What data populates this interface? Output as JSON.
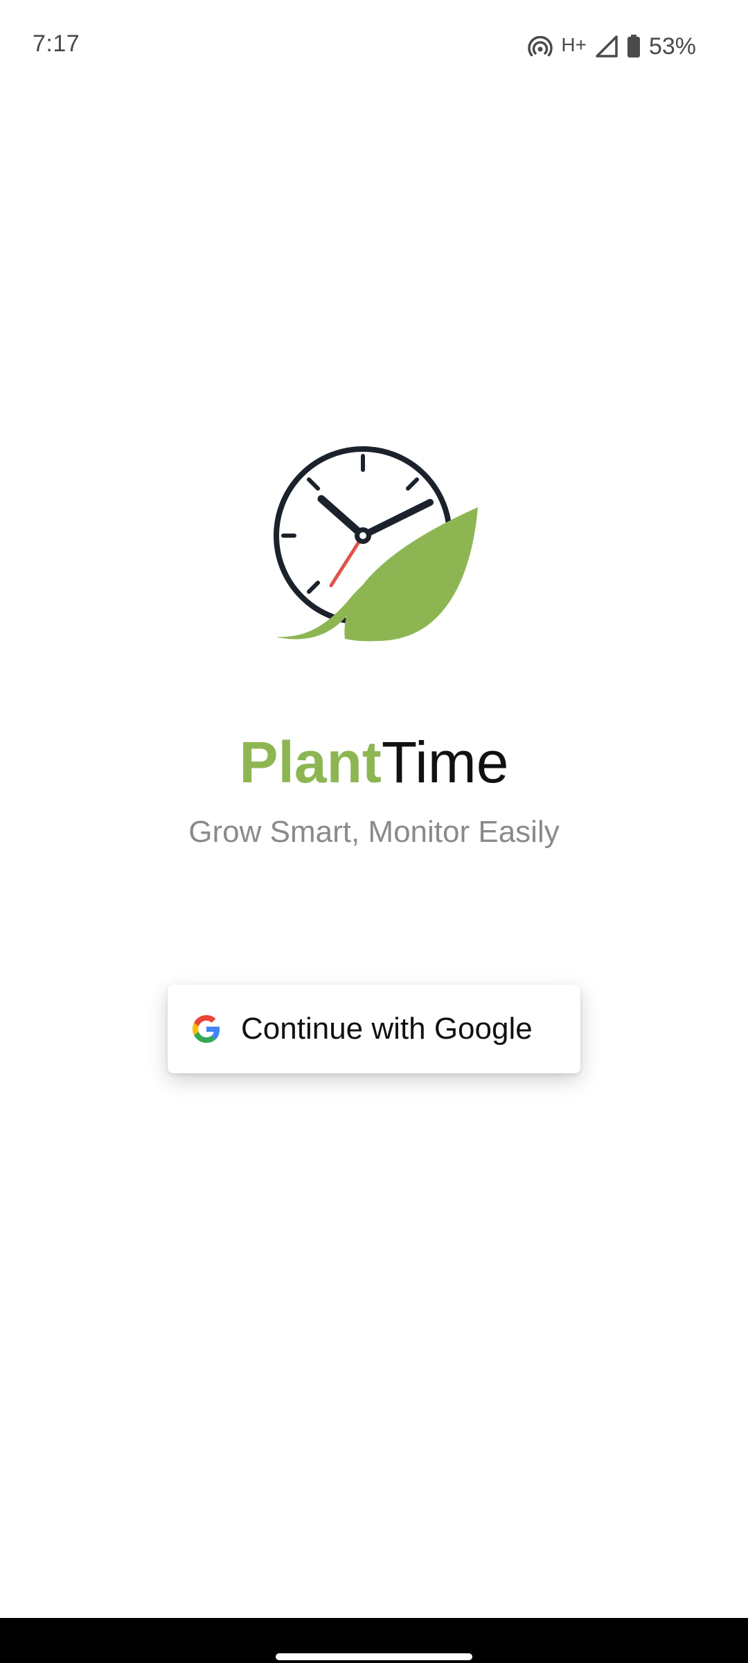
{
  "status_bar": {
    "time": "7:17",
    "network_type": "H+",
    "battery_percent": "53%",
    "icons": [
      "hotspot-icon",
      "signal-icon",
      "battery-icon"
    ]
  },
  "brand": {
    "title_part1": "Plant",
    "title_part2": "Time",
    "tagline": "Grow Smart, Monitor Easily",
    "colors": {
      "accent_green": "#8db653",
      "dark": "#1b222b",
      "second_hand_red": "#e0534a"
    }
  },
  "login": {
    "google_button_label": "Continue with Google",
    "google_icon": "google-g-icon"
  },
  "navigation": {
    "handle": "gesture-handle"
  }
}
